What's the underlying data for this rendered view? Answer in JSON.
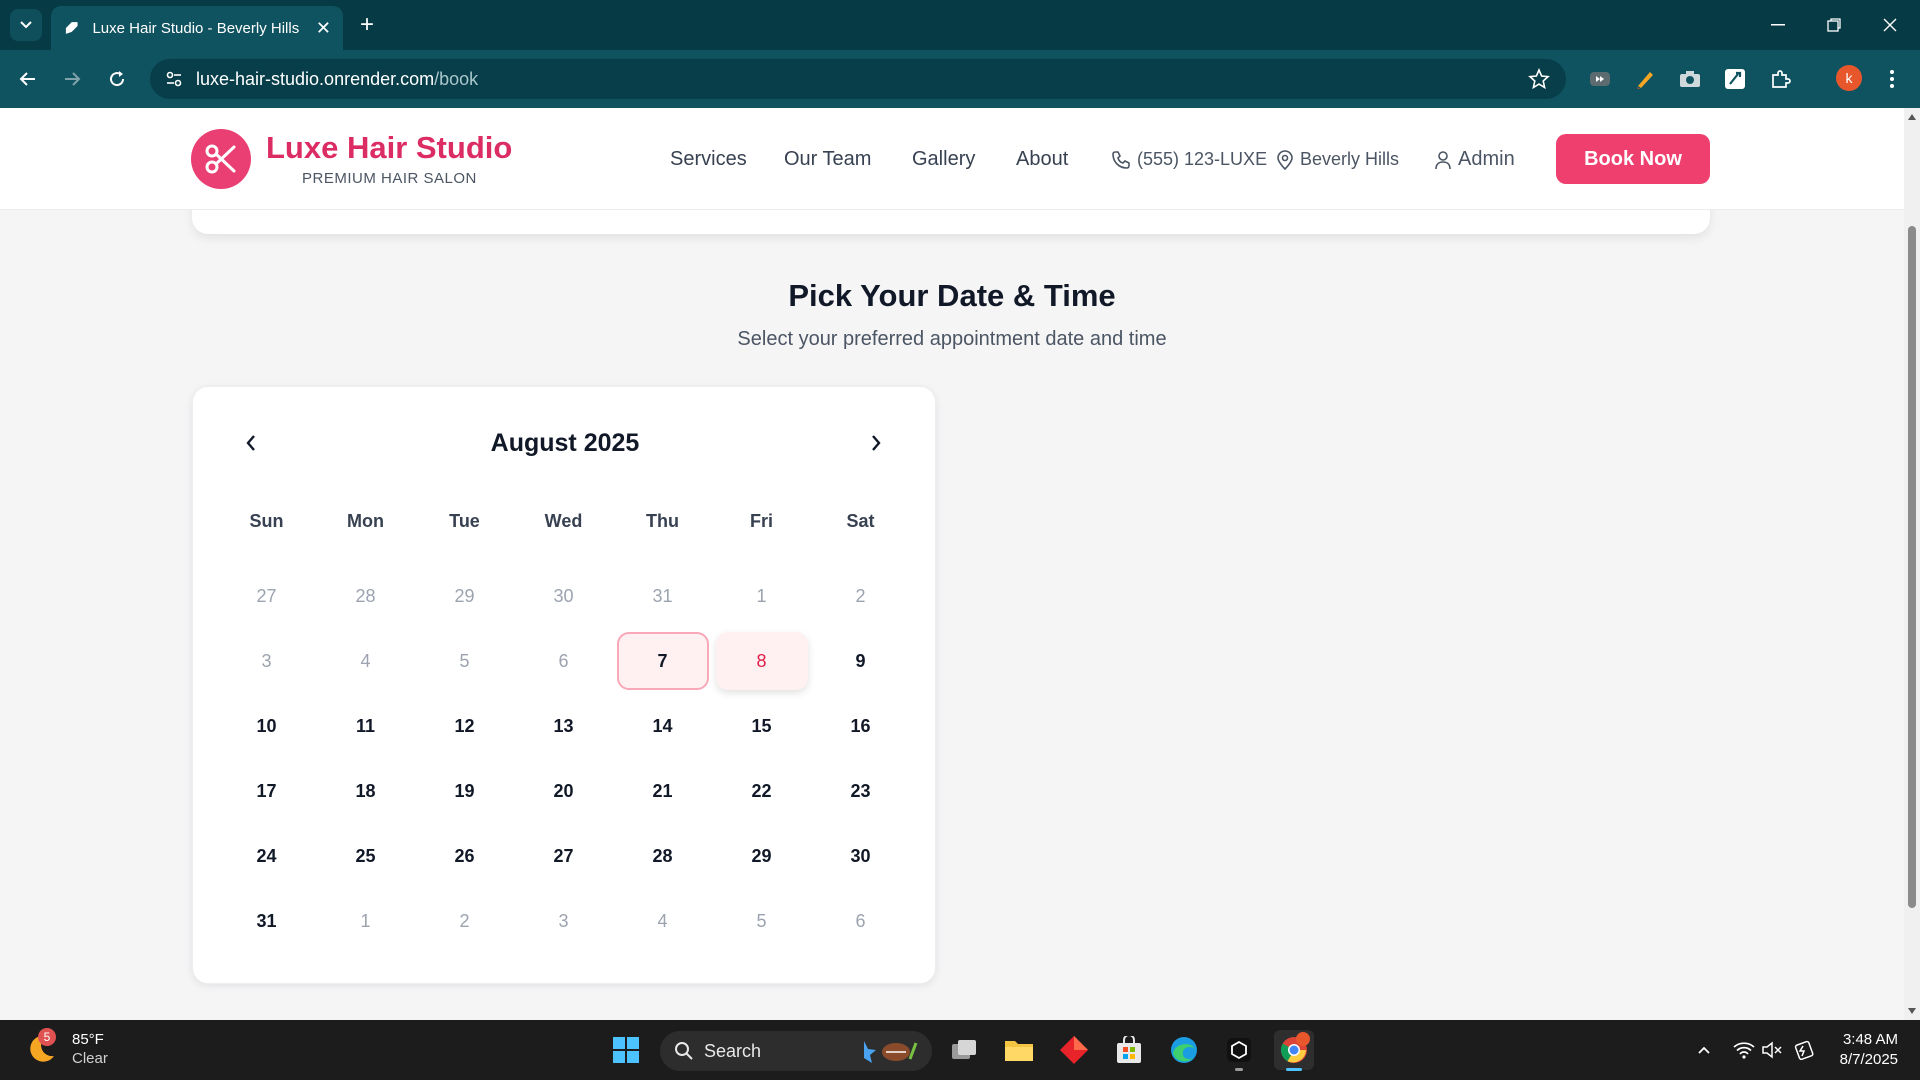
{
  "browser": {
    "tab_title": "Luxe Hair Studio - Beverly Hills",
    "url_host": "luxe-hair-studio.onrender.com",
    "url_path": "/book",
    "profile_initial": "k"
  },
  "site": {
    "brand_name": "Luxe Hair Studio",
    "brand_tagline": "PREMIUM HAIR SALON",
    "nav": [
      "Services",
      "Our Team",
      "Gallery",
      "About"
    ],
    "phone": "(555) 123-LUXE",
    "location": "Beverly Hills",
    "admin": "Admin",
    "cta": "Book Now",
    "accent_color": "#ef3f6e"
  },
  "booking": {
    "title": "Pick Your Date & Time",
    "subtitle": "Select your preferred appointment date and time"
  },
  "calendar": {
    "month_label": "August 2025",
    "weekdays": [
      "Sun",
      "Mon",
      "Tue",
      "Wed",
      "Thu",
      "Fri",
      "Sat"
    ],
    "days": [
      {
        "n": "27",
        "state": "muted"
      },
      {
        "n": "28",
        "state": "muted"
      },
      {
        "n": "29",
        "state": "muted"
      },
      {
        "n": "30",
        "state": "muted"
      },
      {
        "n": "31",
        "state": "muted"
      },
      {
        "n": "1",
        "state": "muted"
      },
      {
        "n": "2",
        "state": "muted"
      },
      {
        "n": "3",
        "state": "muted"
      },
      {
        "n": "4",
        "state": "muted"
      },
      {
        "n": "5",
        "state": "muted"
      },
      {
        "n": "6",
        "state": "muted"
      },
      {
        "n": "7",
        "state": "today"
      },
      {
        "n": "8",
        "state": "selected"
      },
      {
        "n": "9",
        "state": "available"
      },
      {
        "n": "10",
        "state": "available"
      },
      {
        "n": "11",
        "state": "available"
      },
      {
        "n": "12",
        "state": "available"
      },
      {
        "n": "13",
        "state": "available"
      },
      {
        "n": "14",
        "state": "available"
      },
      {
        "n": "15",
        "state": "available"
      },
      {
        "n": "16",
        "state": "available"
      },
      {
        "n": "17",
        "state": "available"
      },
      {
        "n": "18",
        "state": "available"
      },
      {
        "n": "19",
        "state": "available"
      },
      {
        "n": "20",
        "state": "available"
      },
      {
        "n": "21",
        "state": "available"
      },
      {
        "n": "22",
        "state": "available"
      },
      {
        "n": "23",
        "state": "available"
      },
      {
        "n": "24",
        "state": "available"
      },
      {
        "n": "25",
        "state": "available"
      },
      {
        "n": "26",
        "state": "available"
      },
      {
        "n": "27",
        "state": "available"
      },
      {
        "n": "28",
        "state": "available"
      },
      {
        "n": "29",
        "state": "available"
      },
      {
        "n": "30",
        "state": "available"
      },
      {
        "n": "31",
        "state": "available"
      },
      {
        "n": "1",
        "state": "muted"
      },
      {
        "n": "2",
        "state": "muted"
      },
      {
        "n": "3",
        "state": "muted"
      },
      {
        "n": "4",
        "state": "muted"
      },
      {
        "n": "5",
        "state": "muted"
      },
      {
        "n": "6",
        "state": "muted"
      }
    ]
  },
  "taskbar": {
    "weather_badge": "5",
    "weather_temp": "85°F",
    "weather_cond": "Clear",
    "search_label": "Search",
    "time": "3:48 AM",
    "date": "8/7/2025"
  }
}
